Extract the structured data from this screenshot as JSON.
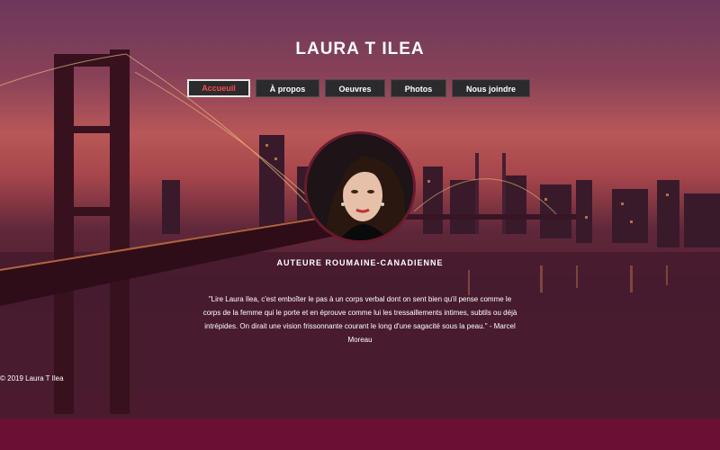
{
  "header": {
    "title": "LAURA T ILEA"
  },
  "nav": {
    "items": [
      {
        "label": "Accueuil",
        "active": true
      },
      {
        "label": "À propos",
        "active": false
      },
      {
        "label": "Oeuvres",
        "active": false
      },
      {
        "label": "Photos",
        "active": false
      },
      {
        "label": "Nous joindre",
        "active": false
      }
    ]
  },
  "profile": {
    "subtitle": "AUTEURE ROUMAINE-CANADIENNE",
    "quote": "\"Lire Laura Ilea, c'est emboîter le pas à un corps verbal dont on sent bien qu'il pense comme le corps de la femme qui le porte et en éprouve comme lui les tressaillements intimes, subtils ou déjà intrépides. On dirait une vision frissonnante courant le long d'une sagacité sous la peau.\" - Marcel Moreau"
  },
  "footer": {
    "copyright": "© 2019 Laura T Ilea"
  },
  "colors": {
    "accent": "#ff4a4a",
    "footer_bar": "#6b1034",
    "nav_bg": "#2b2b2e"
  }
}
